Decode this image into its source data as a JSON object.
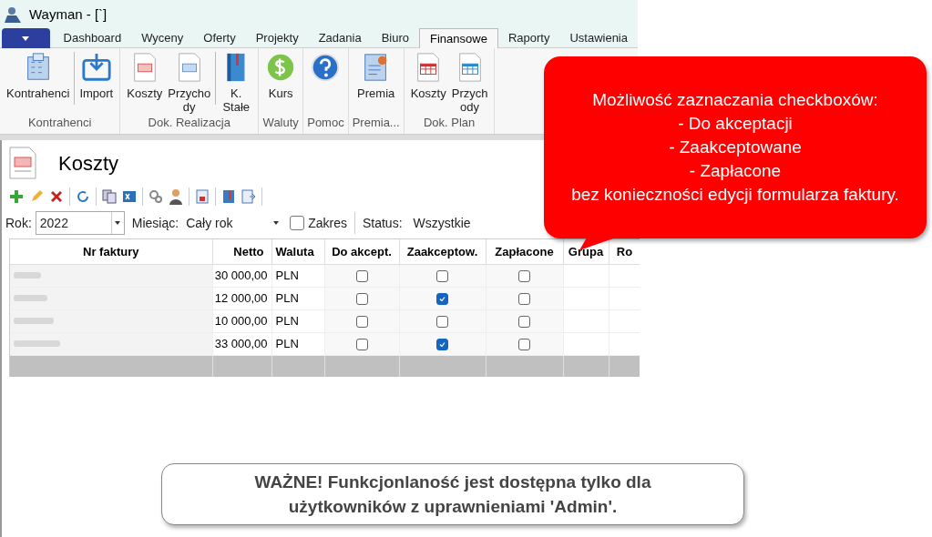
{
  "window": {
    "title": "Wayman - [`]"
  },
  "tabs": [
    {
      "label": "Dashboard",
      "selected": false
    },
    {
      "label": "Wyceny",
      "selected": false
    },
    {
      "label": "Oferty",
      "selected": false
    },
    {
      "label": "Projekty",
      "selected": false
    },
    {
      "label": "Zadania",
      "selected": false
    },
    {
      "label": "Biuro",
      "selected": false
    },
    {
      "label": "Finansowe",
      "selected": true
    },
    {
      "label": "Raporty",
      "selected": false
    },
    {
      "label": "Ustawienia",
      "selected": false
    }
  ],
  "ribbon_groups": [
    {
      "label": "Kontrahenci",
      "buttons": [
        "Kontrahenci",
        "Import"
      ]
    },
    {
      "label": "Dok. Realizacja",
      "buttons": [
        "Koszty",
        "Przycho dy",
        "K. Stałe"
      ]
    },
    {
      "label": "Waluty",
      "buttons": [
        "Kurs"
      ]
    },
    {
      "label": "Pomoc"
    },
    {
      "label": "Premia...",
      "buttons": [
        "Premia"
      ]
    },
    {
      "label": "Dok. Plan",
      "buttons": [
        "Koszty",
        "Przych ody"
      ]
    }
  ],
  "document": {
    "title": "Koszty"
  },
  "filters": {
    "year_label": "Rok:",
    "year": "2022",
    "month_label": "Miesiąc:",
    "month": "Cały rok",
    "range_label": "Zakres",
    "range_checked": false,
    "status_label": "Status:",
    "status": "Wszystkie"
  },
  "table": {
    "columns": [
      "Nr faktury",
      "Netto",
      "Waluta",
      "Do akcept.",
      "Zaakceptow.",
      "Zapłacone",
      "Grupa",
      "Ro"
    ],
    "rows": [
      {
        "netto": "30 000,00",
        "waluta": "PLN",
        "do_akceptacji": false,
        "zaakceptowane": false,
        "zaplacone": false
      },
      {
        "netto": "12 000,00",
        "waluta": "PLN",
        "do_akceptacji": false,
        "zaakceptowane": true,
        "zaplacone": false
      },
      {
        "netto": "10 000,00",
        "waluta": "PLN",
        "do_akceptacji": false,
        "zaakceptowane": false,
        "zaplacone": false
      },
      {
        "netto": "33 000,00",
        "waluta": "PLN",
        "do_akceptacji": false,
        "zaakceptowane": true,
        "zaplacone": false
      }
    ]
  },
  "callout": {
    "lines": [
      "Możliwość zaznaczania checkboxów:",
      "- Do akceptacji",
      "- Zaakceptowane",
      "- Zapłacone",
      "bez konieczności edycji formularza faktury."
    ]
  },
  "note": {
    "text": "**WAŻNE!** Funkcjonlaność jest dostępna tylko dla użytkowników z uprawnieniami 'Admin'."
  }
}
